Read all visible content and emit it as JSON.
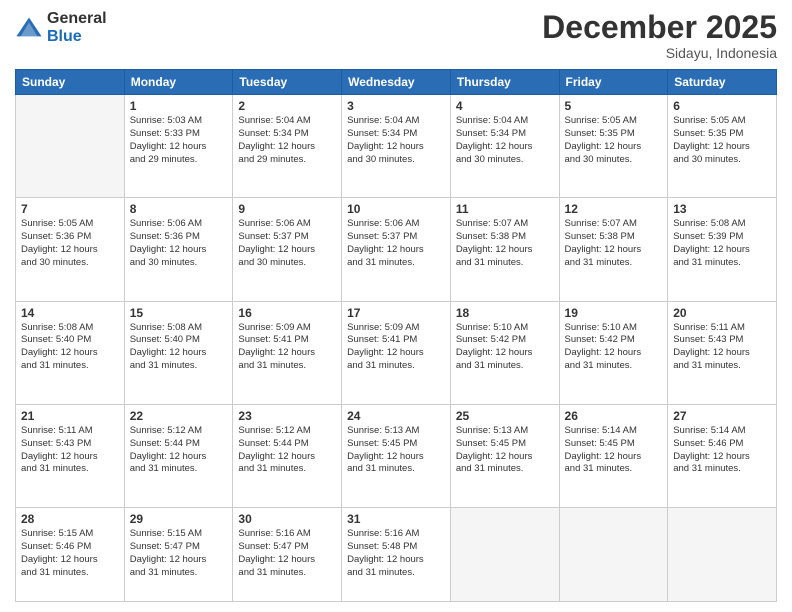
{
  "logo": {
    "general": "General",
    "blue": "Blue"
  },
  "header": {
    "month": "December 2025",
    "location": "Sidayu, Indonesia"
  },
  "days_of_week": [
    "Sunday",
    "Monday",
    "Tuesday",
    "Wednesday",
    "Thursday",
    "Friday",
    "Saturday"
  ],
  "weeks": [
    [
      {
        "day": "",
        "info": ""
      },
      {
        "day": "1",
        "info": "Sunrise: 5:03 AM\nSunset: 5:33 PM\nDaylight: 12 hours\nand 29 minutes."
      },
      {
        "day": "2",
        "info": "Sunrise: 5:04 AM\nSunset: 5:34 PM\nDaylight: 12 hours\nand 29 minutes."
      },
      {
        "day": "3",
        "info": "Sunrise: 5:04 AM\nSunset: 5:34 PM\nDaylight: 12 hours\nand 30 minutes."
      },
      {
        "day": "4",
        "info": "Sunrise: 5:04 AM\nSunset: 5:34 PM\nDaylight: 12 hours\nand 30 minutes."
      },
      {
        "day": "5",
        "info": "Sunrise: 5:05 AM\nSunset: 5:35 PM\nDaylight: 12 hours\nand 30 minutes."
      },
      {
        "day": "6",
        "info": "Sunrise: 5:05 AM\nSunset: 5:35 PM\nDaylight: 12 hours\nand 30 minutes."
      }
    ],
    [
      {
        "day": "7",
        "info": "Sunrise: 5:05 AM\nSunset: 5:36 PM\nDaylight: 12 hours\nand 30 minutes."
      },
      {
        "day": "8",
        "info": "Sunrise: 5:06 AM\nSunset: 5:36 PM\nDaylight: 12 hours\nand 30 minutes."
      },
      {
        "day": "9",
        "info": "Sunrise: 5:06 AM\nSunset: 5:37 PM\nDaylight: 12 hours\nand 30 minutes."
      },
      {
        "day": "10",
        "info": "Sunrise: 5:06 AM\nSunset: 5:37 PM\nDaylight: 12 hours\nand 31 minutes."
      },
      {
        "day": "11",
        "info": "Sunrise: 5:07 AM\nSunset: 5:38 PM\nDaylight: 12 hours\nand 31 minutes."
      },
      {
        "day": "12",
        "info": "Sunrise: 5:07 AM\nSunset: 5:38 PM\nDaylight: 12 hours\nand 31 minutes."
      },
      {
        "day": "13",
        "info": "Sunrise: 5:08 AM\nSunset: 5:39 PM\nDaylight: 12 hours\nand 31 minutes."
      }
    ],
    [
      {
        "day": "14",
        "info": "Sunrise: 5:08 AM\nSunset: 5:40 PM\nDaylight: 12 hours\nand 31 minutes."
      },
      {
        "day": "15",
        "info": "Sunrise: 5:08 AM\nSunset: 5:40 PM\nDaylight: 12 hours\nand 31 minutes."
      },
      {
        "day": "16",
        "info": "Sunrise: 5:09 AM\nSunset: 5:41 PM\nDaylight: 12 hours\nand 31 minutes."
      },
      {
        "day": "17",
        "info": "Sunrise: 5:09 AM\nSunset: 5:41 PM\nDaylight: 12 hours\nand 31 minutes."
      },
      {
        "day": "18",
        "info": "Sunrise: 5:10 AM\nSunset: 5:42 PM\nDaylight: 12 hours\nand 31 minutes."
      },
      {
        "day": "19",
        "info": "Sunrise: 5:10 AM\nSunset: 5:42 PM\nDaylight: 12 hours\nand 31 minutes."
      },
      {
        "day": "20",
        "info": "Sunrise: 5:11 AM\nSunset: 5:43 PM\nDaylight: 12 hours\nand 31 minutes."
      }
    ],
    [
      {
        "day": "21",
        "info": "Sunrise: 5:11 AM\nSunset: 5:43 PM\nDaylight: 12 hours\nand 31 minutes."
      },
      {
        "day": "22",
        "info": "Sunrise: 5:12 AM\nSunset: 5:44 PM\nDaylight: 12 hours\nand 31 minutes."
      },
      {
        "day": "23",
        "info": "Sunrise: 5:12 AM\nSunset: 5:44 PM\nDaylight: 12 hours\nand 31 minutes."
      },
      {
        "day": "24",
        "info": "Sunrise: 5:13 AM\nSunset: 5:45 PM\nDaylight: 12 hours\nand 31 minutes."
      },
      {
        "day": "25",
        "info": "Sunrise: 5:13 AM\nSunset: 5:45 PM\nDaylight: 12 hours\nand 31 minutes."
      },
      {
        "day": "26",
        "info": "Sunrise: 5:14 AM\nSunset: 5:45 PM\nDaylight: 12 hours\nand 31 minutes."
      },
      {
        "day": "27",
        "info": "Sunrise: 5:14 AM\nSunset: 5:46 PM\nDaylight: 12 hours\nand 31 minutes."
      }
    ],
    [
      {
        "day": "28",
        "info": "Sunrise: 5:15 AM\nSunset: 5:46 PM\nDaylight: 12 hours\nand 31 minutes."
      },
      {
        "day": "29",
        "info": "Sunrise: 5:15 AM\nSunset: 5:47 PM\nDaylight: 12 hours\nand 31 minutes."
      },
      {
        "day": "30",
        "info": "Sunrise: 5:16 AM\nSunset: 5:47 PM\nDaylight: 12 hours\nand 31 minutes."
      },
      {
        "day": "31",
        "info": "Sunrise: 5:16 AM\nSunset: 5:48 PM\nDaylight: 12 hours\nand 31 minutes."
      },
      {
        "day": "",
        "info": ""
      },
      {
        "day": "",
        "info": ""
      },
      {
        "day": "",
        "info": ""
      }
    ]
  ]
}
